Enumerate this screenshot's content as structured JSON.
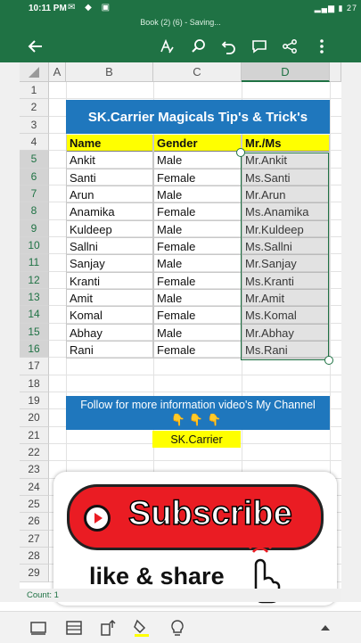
{
  "status_bar": {
    "time": "10:11 PM",
    "battery": "27"
  },
  "titlebar": {
    "title": "Book (2) (6) - Saving..."
  },
  "columns": [
    "A",
    "B",
    "C",
    "D"
  ],
  "rows": [
    "1",
    "2",
    "3",
    "4",
    "5",
    "6",
    "7",
    "8",
    "9",
    "10",
    "11",
    "12",
    "13",
    "14",
    "15",
    "16",
    "17",
    "18",
    "19",
    "20",
    "21",
    "22",
    "23",
    "24",
    "25",
    "26",
    "27",
    "28",
    "29"
  ],
  "banner": {
    "title": "SK.Carrier Magicals Tip's & Trick's"
  },
  "table": {
    "headers": [
      "Name",
      "Gender",
      "Mr./Ms"
    ],
    "rows": [
      [
        "Ankit",
        "Male",
        "Mr.Ankit"
      ],
      [
        "Santi",
        "Female",
        "Ms.Santi"
      ],
      [
        "Arun",
        "Male",
        "Mr.Arun"
      ],
      [
        "Anamika",
        "Female",
        "Ms.Anamika"
      ],
      [
        "Kuldeep",
        "Male",
        "Mr.Kuldeep"
      ],
      [
        "Sallni",
        "Female",
        "Ms.Sallni"
      ],
      [
        "Sanjay",
        "Male",
        "Mr.Sanjay"
      ],
      [
        "Kranti",
        "Female",
        "Ms.Kranti"
      ],
      [
        "Amit",
        "Male",
        "Mr.Amit"
      ],
      [
        "Komal",
        "Female",
        "Ms.Komal"
      ],
      [
        "Abhay",
        "Male",
        "Mr.Abhay"
      ],
      [
        "Rani",
        "Female",
        "Ms.Rani"
      ]
    ]
  },
  "follow": {
    "text": "Follow for more information video's My Channel",
    "hands": "👇👇👇"
  },
  "channel_tag": "SK.Carrier",
  "overlay": {
    "subscribe": "Subscribe",
    "like_share": "like & share"
  },
  "status": {
    "count": "Count: 1"
  },
  "colors": {
    "excel_green": "#1f7244",
    "banner_blue": "#1f77bd",
    "header_yellow": "#ffff00",
    "subscribe_red": "#ea1c23"
  },
  "icons": {
    "toolbar": [
      "back-arrow-icon",
      "text-format-icon",
      "search-icon",
      "undo-icon",
      "comment-icon",
      "share-icon",
      "more-icon"
    ],
    "bottom": [
      "sheet-view-icon",
      "card-view-icon",
      "insert-icon",
      "fill-color-icon",
      "tell-me-icon",
      "collapse-up-icon"
    ]
  }
}
